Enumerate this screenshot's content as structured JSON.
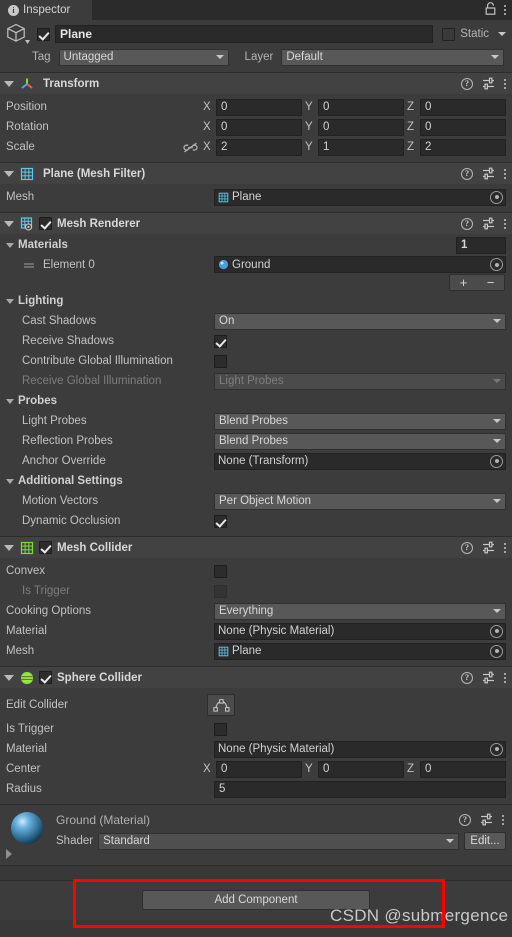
{
  "window": {
    "tab_label": "Inspector",
    "info_icon": "info-icon",
    "lock_icon": "lock-icon",
    "menu_icon": "kebab-menu-icon"
  },
  "object_header": {
    "icon": "gameobject-cube-icon",
    "enabled": true,
    "name": "Plane",
    "static_label": "Static",
    "static_checked": false,
    "tag_label": "Tag",
    "tag_value": "Untagged",
    "layer_label": "Layer",
    "layer_value": "Default"
  },
  "components": [
    {
      "id": "transform",
      "title": "Transform",
      "icon": "transform-axes-icon",
      "has_checkbox": false,
      "rows": [
        {
          "label": "Position",
          "type": "xyz",
          "x": "0",
          "y": "0",
          "z": "0"
        },
        {
          "label": "Rotation",
          "type": "xyz",
          "x": "0",
          "y": "0",
          "z": "0"
        },
        {
          "label": "Scale",
          "type": "xyz",
          "x": "2",
          "y": "1",
          "z": "2",
          "link_icon": "constrain-proportions-off-icon"
        }
      ]
    },
    {
      "id": "mesh-filter",
      "title": "Plane (Mesh Filter)",
      "icon": "mesh-filter-icon",
      "has_checkbox": false,
      "rows": [
        {
          "label": "Mesh",
          "type": "object",
          "value": "Plane",
          "value_icon": "mesh-grid-icon"
        }
      ]
    },
    {
      "id": "mesh-renderer",
      "title": "Mesh Renderer",
      "icon": "mesh-renderer-icon",
      "has_checkbox": true,
      "checked": true,
      "materials": {
        "header": "Materials",
        "size": "1",
        "element_label": "Element 0",
        "element_value": "Ground",
        "element_icon": "material-sphere-icon",
        "add_label": "+",
        "remove_label": "−"
      },
      "groups": [
        {
          "header": "Lighting",
          "rows": [
            {
              "label": "Cast Shadows",
              "type": "dropdown",
              "value": "On"
            },
            {
              "label": "Receive Shadows",
              "type": "checkbox",
              "checked": true
            },
            {
              "label": "Contribute Global Illumination",
              "type": "checkbox",
              "checked": false
            },
            {
              "label": "Receive Global Illumination",
              "type": "dropdown",
              "value": "Light Probes",
              "disabled": true
            }
          ]
        },
        {
          "header": "Probes",
          "rows": [
            {
              "label": "Light Probes",
              "type": "dropdown",
              "value": "Blend Probes"
            },
            {
              "label": "Reflection Probes",
              "type": "dropdown",
              "value": "Blend Probes"
            },
            {
              "label": "Anchor Override",
              "type": "object",
              "value": "None (Transform)"
            }
          ]
        },
        {
          "header": "Additional Settings",
          "rows": [
            {
              "label": "Motion Vectors",
              "type": "dropdown",
              "value": "Per Object Motion"
            },
            {
              "label": "Dynamic Occlusion",
              "type": "checkbox",
              "checked": true
            }
          ]
        }
      ]
    },
    {
      "id": "mesh-collider",
      "title": "Mesh Collider",
      "icon": "mesh-collider-icon",
      "has_checkbox": true,
      "checked": true,
      "rows": [
        {
          "label": "Convex",
          "type": "checkbox",
          "checked": false
        },
        {
          "label": "Is Trigger",
          "type": "checkbox",
          "checked": false,
          "disabled": true,
          "indent": true
        },
        {
          "label": "Cooking Options",
          "type": "dropdown",
          "value": "Everything"
        },
        {
          "label": "Material",
          "type": "object",
          "value": "None (Physic Material)"
        },
        {
          "label": "Mesh",
          "type": "object",
          "value": "Plane",
          "value_icon": "mesh-grid-icon"
        }
      ]
    },
    {
      "id": "sphere-collider",
      "title": "Sphere Collider",
      "icon": "sphere-collider-icon",
      "has_checkbox": true,
      "checked": true,
      "rows": [
        {
          "label": "Edit Collider",
          "type": "button",
          "button_icon": "edit-collider-icon"
        },
        {
          "label": "Is Trigger",
          "type": "checkbox",
          "checked": false
        },
        {
          "label": "Material",
          "type": "object",
          "value": "None (Physic Material)"
        },
        {
          "label": "Center",
          "type": "xyz",
          "x": "0",
          "y": "0",
          "z": "0"
        },
        {
          "label": "Radius",
          "type": "number",
          "value": "5"
        }
      ]
    }
  ],
  "material_preview": {
    "title": "Ground (Material)",
    "icon": "material-sphere-preview",
    "expand_icon": "foldout-right-icon",
    "shader_label": "Shader",
    "shader_value": "Standard",
    "edit_label": "Edit..."
  },
  "footer": {
    "add_component_label": "Add Component",
    "watermark": "CSDN @submergence",
    "highlight_color": "#ff0000"
  }
}
